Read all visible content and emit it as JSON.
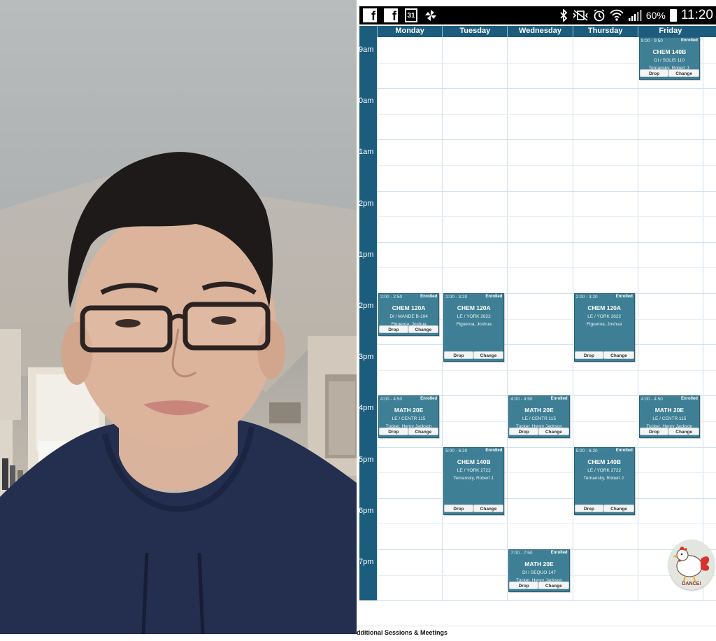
{
  "status_bar": {
    "left_icons": [
      "facebook-icon",
      "facebook-icon",
      "calendar-icon",
      "pinwheel-icon"
    ],
    "calendar_day": "31",
    "right_icons": [
      "bluetooth-icon",
      "vibrate-mute-icon",
      "alarm-icon",
      "wifi-icon",
      "signal-icon",
      "battery-icon"
    ],
    "battery": "60%",
    "time": "11:20"
  },
  "schedule": {
    "days": [
      "Monday",
      "Tuesday",
      "Wednesday",
      "Thursday",
      "Friday"
    ],
    "times": [
      "9am",
      "0am",
      "1am",
      "2pm",
      "1pm",
      "2pm",
      "3pm",
      "4pm",
      "5pm",
      "6pm",
      "7pm"
    ],
    "drop_label": "Drop",
    "change_label": "Change",
    "courses": [
      {
        "day": "Friday",
        "time": "9:00 - 9:50",
        "status": "Enrolled",
        "name": "CHEM 140B",
        "location": "DI / SOLIS 110",
        "instructor": "Ternansky, Robert J."
      },
      {
        "day": "Monday",
        "time": "2:00 - 2:50",
        "status": "Enrolled",
        "name": "CHEM 120A",
        "location": "DI / MANDE B-104",
        "instructor": "Figueroa, Joshua"
      },
      {
        "day": "Tuesday",
        "time": "2:00 - 3:20",
        "status": "Enrolled",
        "name": "CHEM 120A",
        "location": "LE / YORK 2622",
        "instructor": "Figueroa, Joshua"
      },
      {
        "day": "Thursday",
        "time": "2:00 - 3:20",
        "status": "Enrolled",
        "name": "CHEM 120A",
        "location": "LE / YORK 2622",
        "instructor": "Figueroa, Joshua"
      },
      {
        "day": "Monday",
        "time": "4:00 - 4:50",
        "status": "Enrolled",
        "name": "MATH 20E",
        "location": "LE / CENTR 115",
        "instructor": "Tucker, Henry Jackson"
      },
      {
        "day": "Wednesday",
        "time": "4:00 - 4:50",
        "status": "Enrolled",
        "name": "MATH 20E",
        "location": "LE / CENTR 115",
        "instructor": "Tucker, Henry Jackson"
      },
      {
        "day": "Friday",
        "time": "4:00 - 4:50",
        "status": "Enrolled",
        "name": "MATH 20E",
        "location": "LE / CENTR 115",
        "instructor": "Tucker, Henry Jackson"
      },
      {
        "day": "Tuesday",
        "time": "5:00 - 6:20",
        "status": "Enrolled",
        "name": "CHEM 140B",
        "location": "LE / YORK 2722",
        "instructor": "Ternansky, Robert J."
      },
      {
        "day": "Thursday",
        "time": "5:00 - 6:20",
        "status": "Enrolled",
        "name": "CHEM 140B",
        "location": "LE / YORK 2722",
        "instructor": "Ternansky, Robert J."
      },
      {
        "day": "Wednesday",
        "time": "7:00 - 7:50",
        "status": "Enrolled",
        "name": "MATH 20E",
        "location": "DI / SEQUO 147",
        "instructor": "Tucker, Henry Jackson"
      }
    ]
  },
  "footer": {
    "additional": "dditional Sessions & Meetings"
  },
  "dance_button": {
    "label": "DANCE!",
    "icon": "rooster-icon"
  }
}
